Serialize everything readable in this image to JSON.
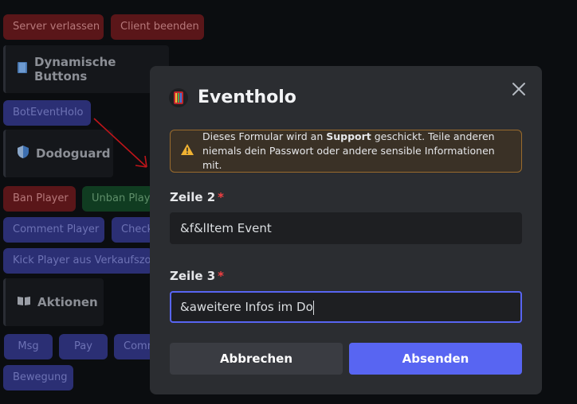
{
  "background": {
    "server_leave": "Server verlassen",
    "client_quit": "Client beenden",
    "section_dynamic": "Dynamische Buttons",
    "bot_event": "BotEventHolo",
    "section_dodoguard": "Dodoguard",
    "ban_player": "Ban Player",
    "unban_player": "Unban Player",
    "comment_player": "Comment Player",
    "check": "Check",
    "kick_player": "Kick Player aus Verkaufszone",
    "section_actions": "Aktionen",
    "msg": "Msg",
    "pay": "Pay",
    "comm": "Comm",
    "movement": "Bewegung"
  },
  "modal": {
    "title": "Eventholo",
    "warning_prefix": "Dieses Formular wird an ",
    "warning_bold": "Support",
    "warning_suffix": " geschickt. Teile anderen niemals dein Passwort oder andere sensible Informationen mit.",
    "field1_label": "Zeile 2",
    "field1_value": "&f&lItem Event",
    "field2_label": "Zeile 3",
    "field2_value": "&aweitere Infos im Do",
    "required_mark": "*",
    "cancel_label": "Abbrechen",
    "submit_label": "Absenden"
  },
  "colors": {
    "accent": "#5865f2",
    "modal_bg": "#2b2d31",
    "warning_border": "#9a6b2d",
    "required": "#f23f42"
  },
  "icons": {
    "close": "close-icon",
    "warning": "warning-icon",
    "app": "app-icon",
    "section": "book-icon",
    "shield": "shield-icon"
  }
}
